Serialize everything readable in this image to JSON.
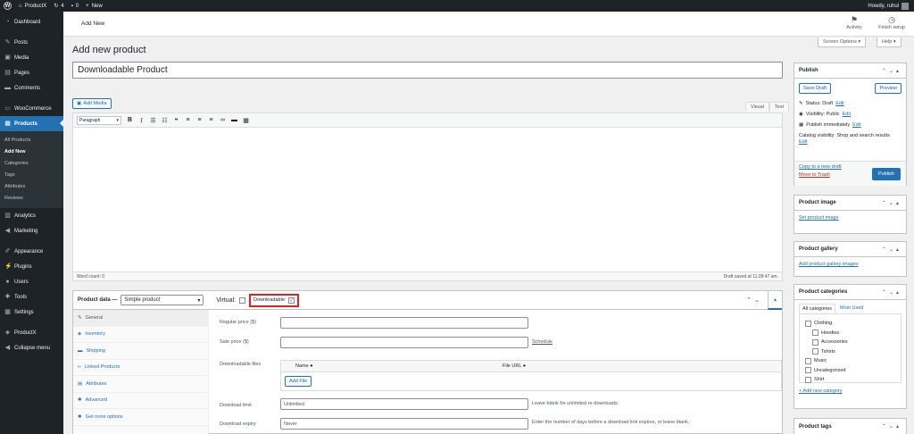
{
  "adminbar": {
    "site": "ProductX",
    "updates": "4",
    "comments": "0",
    "new": "New",
    "howdy": "Howdy, ruhul"
  },
  "sidebar": {
    "items": [
      {
        "label": "Dashboard",
        "icon": "dashboard-icon"
      },
      {
        "label": "Posts",
        "icon": "pin-icon"
      },
      {
        "label": "Media",
        "icon": "media-icon"
      },
      {
        "label": "Pages",
        "icon": "pages-icon"
      },
      {
        "label": "Comments",
        "icon": "comments-icon"
      },
      {
        "label": "WooCommerce",
        "icon": "woo-icon"
      },
      {
        "label": "Products",
        "icon": "products-icon"
      },
      {
        "label": "Analytics",
        "icon": "analytics-icon"
      },
      {
        "label": "Marketing",
        "icon": "megaphone-icon"
      },
      {
        "label": "Appearance",
        "icon": "brush-icon"
      },
      {
        "label": "Plugins",
        "icon": "plugin-icon"
      },
      {
        "label": "Users",
        "icon": "users-icon"
      },
      {
        "label": "Tools",
        "icon": "tools-icon"
      },
      {
        "label": "Settings",
        "icon": "settings-icon"
      },
      {
        "label": "ProductX",
        "icon": "productx-icon"
      },
      {
        "label": "Collapse menu",
        "icon": "collapse-icon"
      }
    ],
    "submenu": [
      "All Products",
      "Add New",
      "Categories",
      "Tags",
      "Attributes",
      "Reviews"
    ]
  },
  "header": {
    "title": "Add New",
    "activity": "Activity",
    "finish_setup": "Finish setup",
    "screen_options": "Screen Options ▾",
    "help": "Help ▾"
  },
  "page": {
    "title": "Add new product",
    "product_name": "Downloadable Product"
  },
  "editor": {
    "add_media": "Add Media",
    "tab_visual": "Visual",
    "tab_text": "Text",
    "format": "Paragraph",
    "word_count": "Word count: 0",
    "draft_saved": "Draft saved at 11:28:47 am."
  },
  "product_data": {
    "label": "Product data —",
    "type": "Simple product",
    "virtual": "Virtual:",
    "downloadable": "Downloadable:",
    "tabs": [
      "General",
      "Inventory",
      "Shipping",
      "Linked Products",
      "Attributes",
      "Advanced",
      "Get more options"
    ],
    "regular_price_label": "Regular price ($)",
    "sale_price_label": "Sale price ($)",
    "schedule": "Schedule",
    "downloadable_files_label": "Downloadable files",
    "col_name": "Name",
    "col_url": "File URL",
    "add_file": "Add File",
    "download_limit_label": "Download limit",
    "download_limit_placeholder": "Unlimited",
    "download_limit_hint": "Leave blank for unlimited re-downloads.",
    "download_expiry_label": "Download expiry",
    "download_expiry_placeholder": "Never",
    "download_expiry_hint": "Enter the number of days before a download link expires, or leave blank."
  },
  "publish": {
    "title": "Publish",
    "save_draft": "Save Draft",
    "preview": "Preview",
    "status": "Status: Draft",
    "visibility": "Visibility: Public",
    "publish_immediately": "Publish immediately",
    "catalog_visibility": "Catalog visibility: Shop and search results",
    "edit": "Edit",
    "copy_draft": "Copy to a new draft",
    "trash": "Move to Trash",
    "publish_btn": "Publish"
  },
  "product_image": {
    "title": "Product image",
    "link": "Set product image"
  },
  "product_gallery": {
    "title": "Product gallery",
    "link": "Add product gallery images"
  },
  "categories": {
    "title": "Product categories",
    "tab_all": "All categories",
    "tab_used": "Most Used",
    "items": [
      "Clothing",
      "Hoodies",
      "Accessories",
      "Tshirts",
      "Music",
      "Uncategorized",
      "Shirt"
    ],
    "add_new": "+ Add new category"
  },
  "product_tags": {
    "title": "Product tags"
  }
}
